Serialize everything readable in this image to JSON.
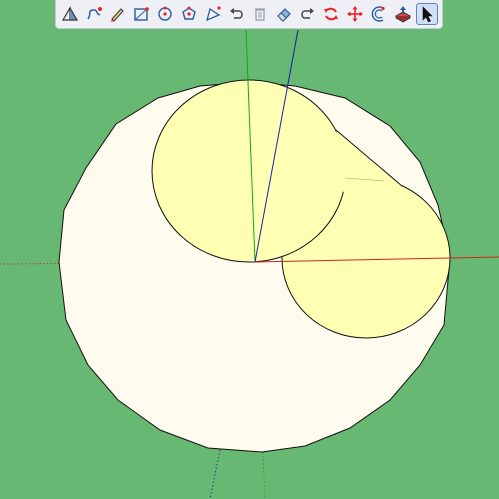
{
  "canvas": {
    "background_color": "#66b872"
  },
  "model": {
    "disk_color": "#fffcef",
    "circle_fill_color": "#ffffb4",
    "edge_color": "#111111"
  },
  "axes": {
    "x_color": "#cc2222",
    "y_color": "#11aa11",
    "z_color": "#1122aa"
  },
  "toolbar": {
    "active_tool": "select",
    "tools": [
      {
        "name": "section-plane-tool",
        "icon": "section-plane-icon"
      },
      {
        "name": "freehand-tool",
        "icon": "freehand-icon"
      },
      {
        "name": "pencil-tool",
        "icon": "pencil-icon"
      },
      {
        "name": "rectangle-tool",
        "icon": "rectangle-icon"
      },
      {
        "name": "circle-tool",
        "icon": "circle-icon"
      },
      {
        "name": "polygon-tool",
        "icon": "polygon-icon"
      },
      {
        "name": "arc-tool",
        "icon": "arc-icon"
      },
      {
        "name": "undo-tool",
        "icon": "undo-icon"
      },
      {
        "name": "delete-tool",
        "icon": "trash-icon"
      },
      {
        "name": "eraser-tool",
        "icon": "eraser-icon"
      },
      {
        "name": "redo-tool",
        "icon": "redo-icon"
      },
      {
        "name": "rotate-tool",
        "icon": "rotate-icon"
      },
      {
        "name": "move-tool",
        "icon": "move-icon"
      },
      {
        "name": "offset-tool",
        "icon": "offset-icon"
      },
      {
        "name": "push-pull-tool",
        "icon": "push-pull-icon"
      },
      {
        "name": "select-tool",
        "icon": "select-arrow-icon"
      }
    ]
  }
}
